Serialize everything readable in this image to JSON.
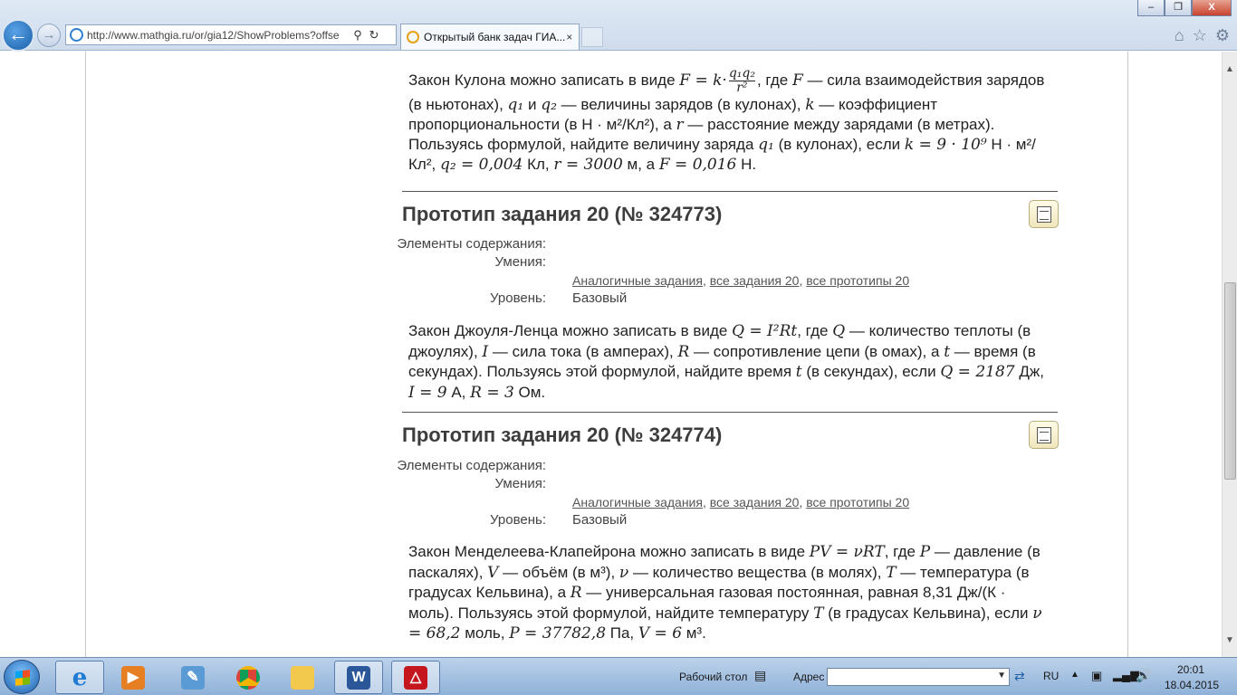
{
  "browser": {
    "url": "http://www.mathgia.ru/or/gia12/ShowProblems?offse",
    "tab_label": "Открытый банк задач ГИА...",
    "close_glyph": "×",
    "win_buttons": [
      "–",
      "❐",
      "X"
    ]
  },
  "problem_top": {
    "t1": "Закон Кулона можно записать в виде ",
    "formula_main": "F = k·",
    "frac_num": "q₁q₂",
    "frac_den": "r²",
    "t2": ", где ",
    "v_F": "F",
    "t3": " — сила взаимодействия зарядов (в ньютонах), ",
    "v_q1": "q₁",
    "t4": " и ",
    "v_q2": "q₂",
    "t5": " — величины зарядов (в кулонах), ",
    "v_k": "k",
    "t6": " — коэффициент пропорциональности (в Н · м²/Кл²), а ",
    "v_r": "r",
    "t7": " — расстояние между зарядами (в метрах). Пользуясь формулой, найдите величину заряда ",
    "v_q1b": "q₁",
    "t8": " (в кулонах), если ",
    "f_k": "k = 9 · 10⁹",
    "t9": " Н · м²/Кл², ",
    "f_q2": "q₂ = 0,004",
    "t10": " Кл, ",
    "f_r": "r = 3000",
    "t11": " м, а ",
    "f_F": "F = 0,016",
    "t12": " Н."
  },
  "items": [
    {
      "heading": "Прототип задания 20 (№ 324773)",
      "lbl_elements": "Элементы содержания:",
      "lbl_skills": "Умения:",
      "link1": "Аналогичные задания",
      "link2": "все задания 20",
      "link3": "все прототипы 20",
      "lbl_level": "Уровень:",
      "level": "Базовый",
      "t1": "Закон Джоуля-Ленца можно записать в виде ",
      "f1": "Q = I²Rt",
      "t2": ", где ",
      "v1": "Q",
      "t3": " — количество теплоты (в джоулях), ",
      "v2": "I",
      "t4": " — сила тока (в амперах), ",
      "v3": "R",
      "t5": " — сопротивление цепи (в омах), а ",
      "v4": "t",
      "t6": " — время (в секундах). Пользуясь этой формулой, найдите время ",
      "v5": "t",
      "t7": " (в секундах), если ",
      "f2": "Q = 2187",
      "t8": " Дж, ",
      "f3": "I = 9",
      "t9": " А, ",
      "f4": "R = 3",
      "t10": " Ом."
    },
    {
      "heading": "Прототип задания 20 (№ 324774)",
      "lbl_elements": "Элементы содержания:",
      "lbl_skills": "Умения:",
      "link1": "Аналогичные задания",
      "link2": "все задания 20",
      "link3": "все прототипы 20",
      "lbl_level": "Уровень:",
      "level": "Базовый",
      "t1": "Закон Менделеева-Клапейрона можно записать в виде ",
      "f1": "PV = νRT",
      "t2": ", где ",
      "v1": "P",
      "t3": " — давление (в паскалях), ",
      "v2": "V",
      "t4": " — объём (в м³), ",
      "v3": "ν",
      "t5": " — количество вещества (в молях), ",
      "v4": "T",
      "t6": " — температура (в градусах Кельвина), а ",
      "v5": "R",
      "t7": " — универсальная газовая постоянная, равная 8,31 Дж/(К · моль). Пользуясь этой формулой, найдите температуру ",
      "v6": "T",
      "t8": " (в градусах Кельвина), если ",
      "f2": "ν = 68,2",
      "t9": " моль, ",
      "f3": "P = 37782,8",
      "t10": " Па, ",
      "f4": "V = 6",
      "t11": " м³."
    }
  ],
  "taskbar": {
    "desktop_label": "Рабочий стол",
    "address_label": "Адрес",
    "lang": "RU",
    "time": "20:01",
    "date": "18.04.2015"
  }
}
